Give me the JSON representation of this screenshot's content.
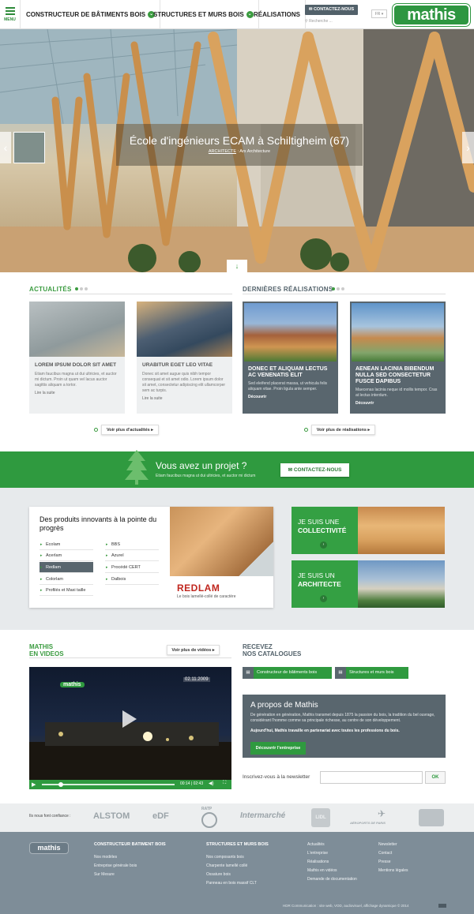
{
  "header": {
    "menu_label": "MENU",
    "nav": [
      "CONSTRUCTEUR DE BÂTIMENTS BOIS",
      "STRUCTURES ET MURS BOIS",
      "RÉALISATIONS"
    ],
    "contact": "CONTACTEZ-NOUS",
    "search_placeholder": "Recherche ...",
    "lang": "FR",
    "logo": "mathis"
  },
  "hero": {
    "title": "École d'ingénieurs ECAM à Schiltigheim (67)",
    "subtitle_label": "ARCHITECTE",
    "subtitle_value": " : Arx Architecture"
  },
  "news": {
    "heading": "ACTUALITÉS",
    "items": [
      {
        "title": "LOREM IPSUM DOLOR SIT AMET",
        "text": "Etiam faucibus magna ut dui ultricies, et auctor mi dictum. Proin ut quam vel lacus auctor sagittis aliquam a tortor.",
        "link": "Lire la suite"
      },
      {
        "title": "URABITUR EGET LEO VITAE",
        "text": "Donec sit amet augue quis nibh tempor consequat et sit amet odio. Lorem ipsum dolor sit amet, consectetur adipiscing elit ullamcorper sem ac turpis.",
        "link": "Lire la suite"
      }
    ],
    "more": "Voir plus d'actualités"
  },
  "works": {
    "heading": "DERNIÈRES RÉALISATIONS",
    "items": [
      {
        "title": "DONEC ET ALIQUAM LECTUS AC VENENATIS ELIT",
        "text": "Sed eleifend placerat massa, ut vehicula felis aliquam vitae. Proin ligula ante semper.",
        "link": "Découvrir"
      },
      {
        "title": "AENEAN LACINIA BIBENDUM NULLA SED CONSECTETUR FUSCE DAPIBUS",
        "text": "Maecenas lacinia neque id mollis tempor. Cras at lectus interdum.",
        "link": "Découvrir"
      }
    ],
    "more": "Voir plus de réalisations"
  },
  "band": {
    "title": "Vous avez un projet ?",
    "text": "Etiam faucibus magna ut dui ultricies, et auctor mi dictum",
    "button": "CONTACTEZ-NOUS"
  },
  "products": {
    "title": "Des produits innovants à la pointe du progrès",
    "col1": [
      "Ecolam",
      "Acerlam",
      "Redlam",
      "Colorlam",
      "Profilés et Maxi taille"
    ],
    "col2": [
      "BBS",
      "Azurel",
      "Procédé CERT",
      "Dalbois"
    ],
    "brand": "REDLAM",
    "tagline": "Le bois lamellé-collé de caractère"
  },
  "roles": [
    {
      "line1": "JE SUIS UNE",
      "line2": "COLLECTIVITÉ"
    },
    {
      "line1": "JE SUIS UN",
      "line2": "ARCHITECTE"
    }
  ],
  "videos": {
    "heading_1": "MATHIS",
    "heading_2": "EN VIDEOS",
    "more": "Voir plus de vidéos",
    "date": "02.11.2009",
    "overlay_logo": "mathis",
    "time_current": "00:14",
    "time_total": "02:43"
  },
  "catalogues": {
    "heading_1": "RECEVEZ",
    "heading_2": "NOS CATALOGUES",
    "buttons": [
      "Constructeur de bâtiments bois",
      "Structures et murs bois"
    ]
  },
  "about": {
    "title": "A propos de Mathis",
    "text": "De génération en génération, Mathis transmet depuis 1875 la passion du bois, la tradition du bel ouvrage, considérant l'homme comme sa principale richesse, au centre de son développement.",
    "bold": "Aujourd'hui, Mathis travaille en partenariat avec toutes les professions du bois.",
    "button": "Découvrir l'entreprise"
  },
  "newsletter": {
    "label": "Inscrivez-vous à la newsletter",
    "button": "OK"
  },
  "partners": {
    "label": "Ils nous font confiance :",
    "logos": [
      "ALSTOM",
      "eDF",
      "RATP",
      "Intermarché",
      "LIDL",
      "AÉROPORTS DE PARIS",
      ""
    ]
  },
  "footer": {
    "logo": "mathis",
    "col1": {
      "heading": "CONSTRUCTEUR BATIMENT BOIS",
      "links": [
        "Nos modèles",
        "Entreprise générale bois",
        "Sur Mesure"
      ]
    },
    "col2": {
      "heading": "STRUCTURES ET MURS BOIS",
      "links": [
        "Nos composants bois",
        "Charpente lamellé collé",
        "Ossature bois",
        "Panneau en bois massif CLT"
      ]
    },
    "col3": [
      "Actualités",
      "L'entreprise",
      "Réalisations",
      "Mathis en vidéos",
      "Demande de documentation"
    ],
    "col4": [
      "Newsletter",
      "Contact",
      "Presse",
      "Mentions légales"
    ],
    "copyright": "HDR Communication : site web, VOD, audiovisuel, affichage dynamique © 2014"
  },
  "colors": {
    "green": "#2f9a3f",
    "slate": "#59666e",
    "footer": "#7e8d98"
  }
}
